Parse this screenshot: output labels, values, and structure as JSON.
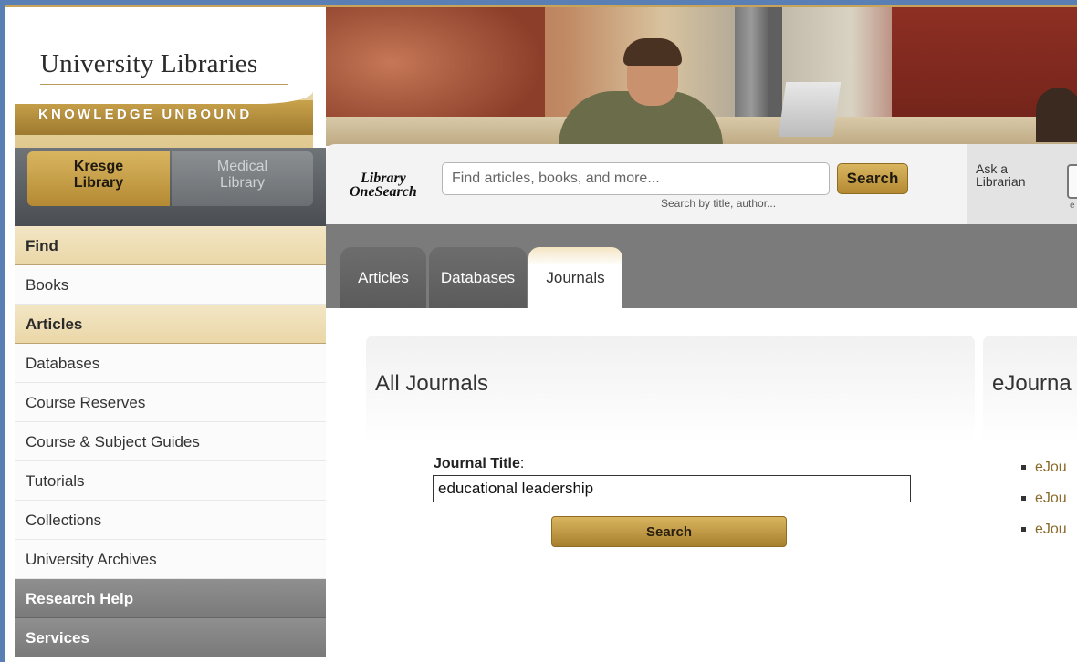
{
  "logo": {
    "title": "University Libraries",
    "tagline": "KNOWLEDGE UNBOUND"
  },
  "library_switch": {
    "kresge": "Kresge\nLibrary",
    "medical": "Medical\nLibrary"
  },
  "nav": {
    "items": [
      {
        "label": "Find"
      },
      {
        "label": "Books"
      },
      {
        "label": "Articles"
      },
      {
        "label": "Databases"
      },
      {
        "label": "Course Reserves"
      },
      {
        "label": "Course & Subject Guides"
      },
      {
        "label": "Tutorials"
      },
      {
        "label": "Collections"
      },
      {
        "label": "University Archives"
      },
      {
        "label": "Research Help"
      },
      {
        "label": "Services"
      }
    ]
  },
  "onesearch": {
    "logo_line1": "Library",
    "logo_line2": "OneSearch",
    "placeholder": "Find articles, books, and more...",
    "search_label": "Search",
    "hint": "Search by title, author..."
  },
  "ask": {
    "label": "Ask a\nLibrarian",
    "icon_caption": "e"
  },
  "tabs": {
    "articles": "Articles",
    "databases": "Databases",
    "journals": "Journals"
  },
  "all_journals": {
    "title": "All Journals",
    "field_label": "Journal Title",
    "field_colon": ":",
    "field_value": "educational leadership",
    "search_label": "Search"
  },
  "ejournals": {
    "title": "eJourna",
    "links": [
      "eJou",
      "eJou",
      "eJou"
    ]
  },
  "colors": {
    "gold": "#c9a24b",
    "nav_head": "#ead7a8",
    "nav_dark": "#7a7a7a",
    "tab_bar": "#7b7b7b",
    "link": "#8a6a2a"
  }
}
